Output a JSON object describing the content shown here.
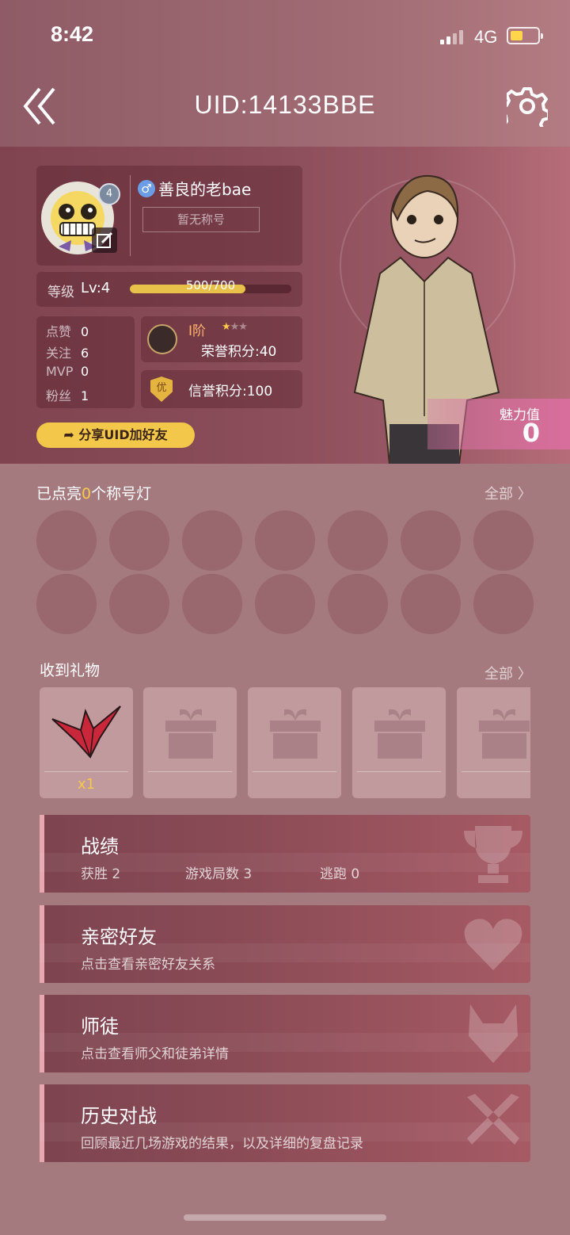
{
  "status_bar": {
    "time": "8:42",
    "network": "4G"
  },
  "header": {
    "title": "UID:14133BBE"
  },
  "profile": {
    "avatar_level": "4",
    "nickname": "善良的老bae",
    "title_placeholder": "暂无称号",
    "level_label": "等级",
    "level_value": "Lv:4",
    "exp_text": "500/700",
    "exp_fraction": 0.714,
    "stats": [
      {
        "label": "点赞",
        "value": "0"
      },
      {
        "label": "关注",
        "value": "6"
      },
      {
        "label": "MVP",
        "value": "0"
      },
      {
        "label": "粉丝",
        "value": "1"
      }
    ],
    "tier": "I阶",
    "stars": "★★★",
    "honor_points": "荣誉积分:40",
    "credit_badge": "优",
    "credit_points": "信誉积分:100",
    "share_button": "分享UID加好友",
    "charm_label": "魅力值",
    "charm_value": "0"
  },
  "title_lamps": {
    "header_prefix": "已点亮",
    "count": "0",
    "header_suffix": "个称号灯",
    "see_all": "全部 〉",
    "lamp_count": 14
  },
  "gifts": {
    "header": "收到礼物",
    "see_all": "全部 〉",
    "items": [
      {
        "name": "paper-crane",
        "qty": "x1"
      },
      {
        "name": "empty-gift",
        "qty": ""
      },
      {
        "name": "empty-gift",
        "qty": ""
      },
      {
        "name": "empty-gift",
        "qty": ""
      },
      {
        "name": "empty-gift",
        "qty": ""
      }
    ]
  },
  "menu": {
    "record": {
      "title": "战绩",
      "wins": "获胜 2",
      "games": "游戏局数 3",
      "escapes": "逃跑 0",
      "icon": "trophy-icon"
    },
    "friends": {
      "title": "亲密好友",
      "subtitle": "点击查看亲密好友关系",
      "icon": "heart-icon"
    },
    "mentor": {
      "title": "师徒",
      "subtitle": "点击查看师父和徒弟详情",
      "icon": "fox-icon"
    },
    "history": {
      "title": "历史对战",
      "subtitle": "回顾最近几场游戏的结果，以及详细的复盘记录",
      "icon": "swords-icon"
    }
  },
  "colors": {
    "accent_gold": "#f2c74a",
    "panel": "#8a4d59",
    "background": "#a57a7f"
  }
}
